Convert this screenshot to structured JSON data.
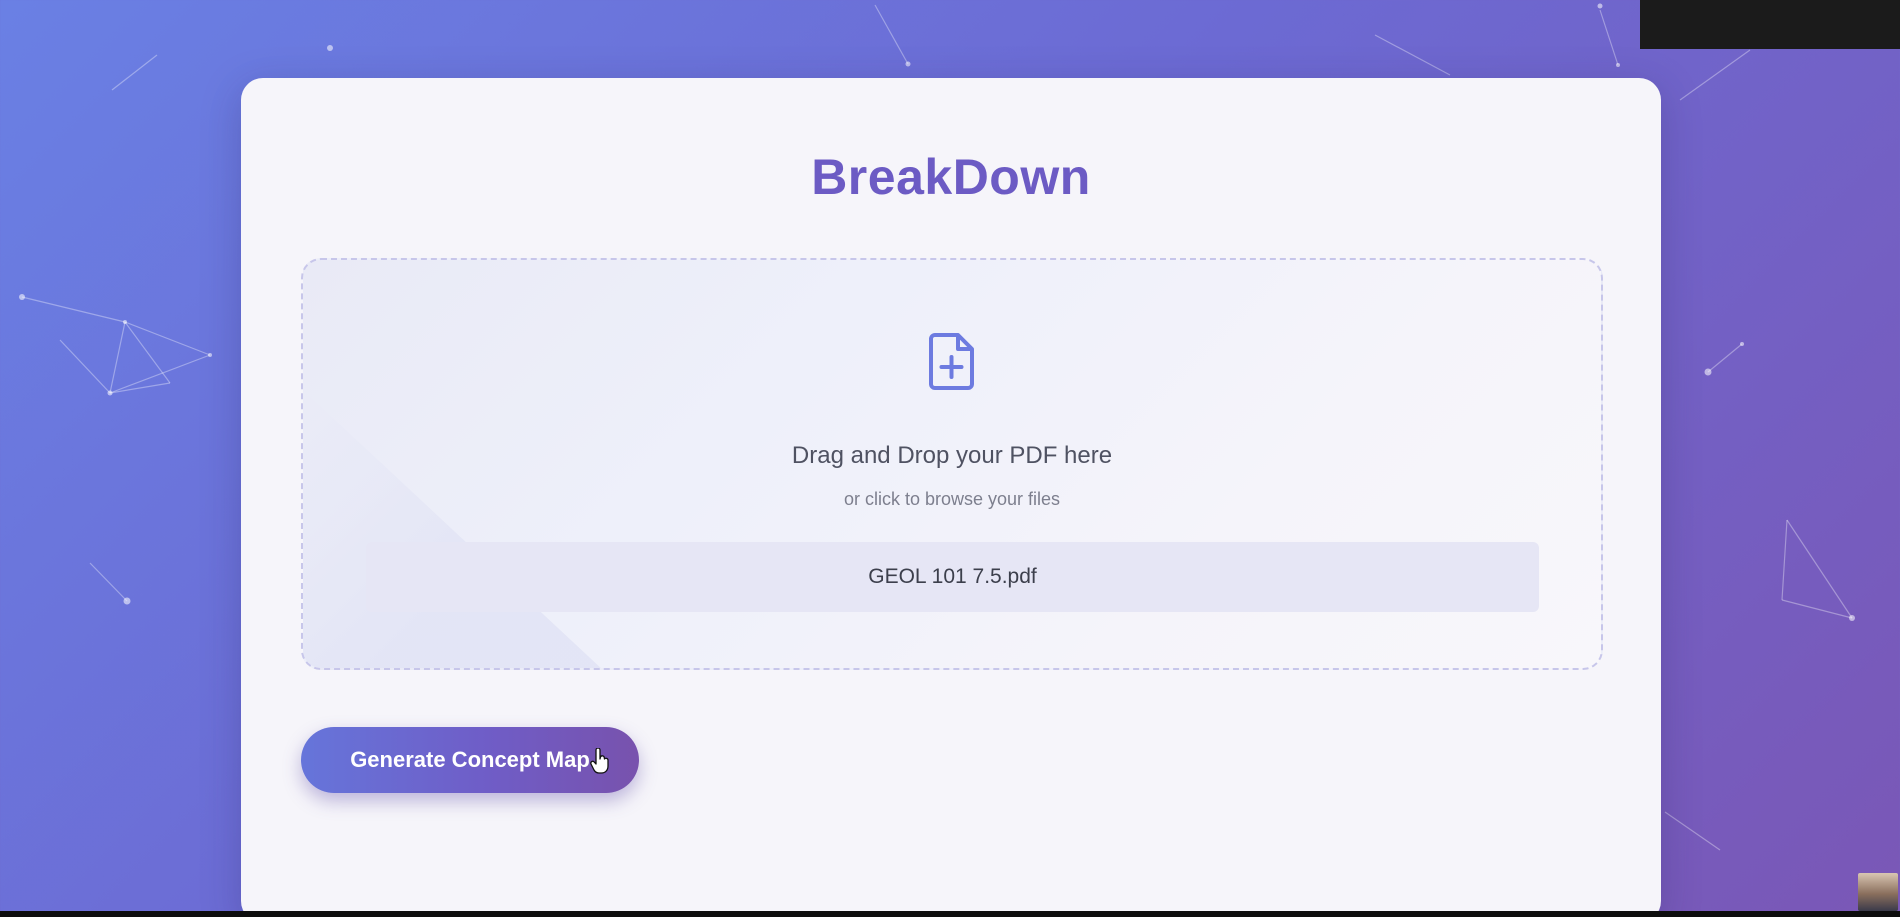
{
  "app": {
    "title": "BreakDown"
  },
  "dropzone": {
    "icon": "file-plus-icon",
    "main_text": "Drag and Drop your PDF here",
    "sub_text": "or click to browse your files"
  },
  "selected_file": {
    "name": "GEOL 101 7.5.pdf"
  },
  "actions": {
    "generate_label": "Generate Concept Map"
  },
  "colors": {
    "accent": "#6c5bc4",
    "background_start": "#6a80e4",
    "background_end": "#7a57b6",
    "card": "#f6f5fa",
    "icon": "#6d7be0"
  }
}
